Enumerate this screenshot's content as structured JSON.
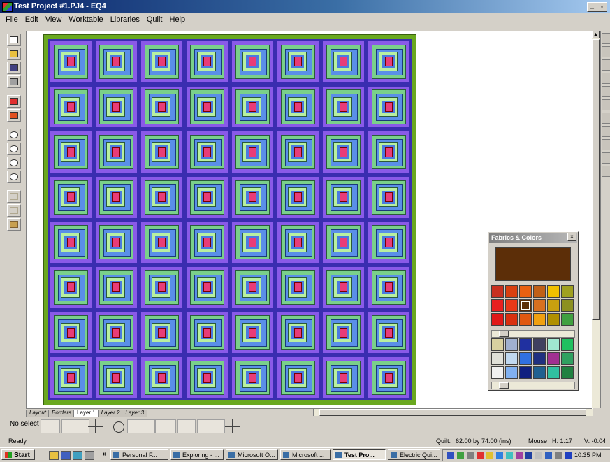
{
  "window": {
    "title": "Test Project #1.PJ4 - EQ4"
  },
  "menu": [
    "File",
    "Edit",
    "View",
    "Worktable",
    "Libraries",
    "Quilt",
    "Help"
  ],
  "tabs": {
    "items": [
      "Layout",
      "Borders",
      "Layer 1",
      "Layer 2",
      "Layer 3"
    ],
    "active": "Layer 1"
  },
  "toolbar_lower": {
    "selection": "No select"
  },
  "status": {
    "left": "Ready",
    "quilt_label": "Quilt:",
    "quilt_size": "62.00 by 74.00 (ins)",
    "mouse_label": "Mouse",
    "mouse_h": "H: 1.17",
    "mouse_v": "V: -0.04"
  },
  "palette": {
    "title": "Fabrics & Colors",
    "selected_color": "#5c2e08",
    "close": "×"
  },
  "taskbar": {
    "start": "Start",
    "chevron": "»",
    "tasks": [
      "Personal F...",
      "Exploring - ...",
      "Microsoft O...",
      "Microsoft ...",
      "Test Pro...",
      "Electric Qui..."
    ],
    "active_task": "Test Pro...",
    "clock": "10:35 PM"
  },
  "colors": {
    "border_green": "#6aa820",
    "sashing_blue": "#3a2db0",
    "block_purple": "#8a5ae8",
    "log_green": "#7ad08a",
    "log_blue": "#5a8fe8",
    "center_pink": "#e83c78"
  }
}
